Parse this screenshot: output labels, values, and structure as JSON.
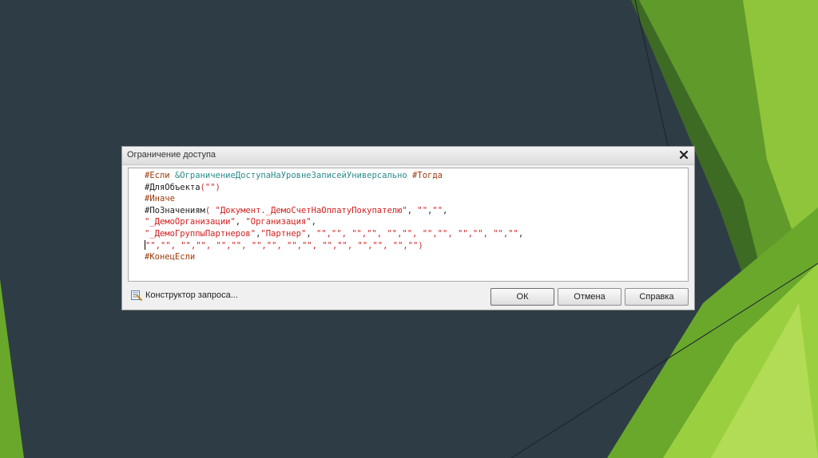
{
  "dialog": {
    "title": "Ограничение доступа",
    "close_icon": "close-icon"
  },
  "editor": {
    "lines": [
      [
        {
          "t": "#Если ",
          "c": "kw-pre"
        },
        {
          "t": "&ОграничениеДоступаНаУровнеЗаписейУниверсально",
          "c": "kw-param"
        },
        {
          "t": " #Тогда",
          "c": "kw-pre"
        }
      ],
      [
        {
          "t": "#ДляОбъекта",
          "c": "func"
        },
        {
          "t": "(",
          "c": "paren"
        },
        {
          "t": "\"\"",
          "c": "str"
        },
        {
          "t": ")",
          "c": "paren"
        }
      ],
      [
        {
          "t": "#Иначе",
          "c": "kw-pre"
        }
      ],
      [
        {
          "t": "#ПоЗначениям",
          "c": "func"
        },
        {
          "t": "( ",
          "c": "paren"
        },
        {
          "t": "\"Документ._ДемоСчетНаОплатуПокупателю\"",
          "c": "str"
        },
        {
          "t": ", ",
          "c": "plain"
        },
        {
          "t": "\"\"",
          "c": "str"
        },
        {
          "t": ",",
          "c": "plain"
        },
        {
          "t": "\"\"",
          "c": "str"
        },
        {
          "t": ",",
          "c": "plain"
        }
      ],
      [
        {
          "t": "\"_ДемоОрганизации\"",
          "c": "str"
        },
        {
          "t": ", ",
          "c": "plain"
        },
        {
          "t": "\"Организация\"",
          "c": "str"
        },
        {
          "t": ",",
          "c": "plain"
        }
      ],
      [
        {
          "t": "\"_ДемоГруппыПартнеров\"",
          "c": "str"
        },
        {
          "t": ",",
          "c": "plain"
        },
        {
          "t": "\"Партнер\"",
          "c": "str"
        },
        {
          "t": ", ",
          "c": "plain"
        },
        {
          "t": "\"\",\"\", \"\",\"\", \"\",\"\", \"\",\"\", \"\",\"\", \"\",\"\"",
          "c": "str"
        },
        {
          "t": ",",
          "c": "plain"
        }
      ],
      [
        {
          "t": "\"\",\"\", \"\",\"\", \"\",\"\", \"\",\"\", \"\",\"\", \"\",\"\", \"\",\"\", \"\",\"\"",
          "c": "str"
        },
        {
          "t": ")",
          "c": "paren"
        }
      ],
      [
        {
          "t": "#КонецЕсли",
          "c": "kw-pre"
        }
      ]
    ]
  },
  "footer": {
    "builder_label": "Конструктор запроса...",
    "builder_icon": "query-builder-icon",
    "ok_label": "ОК",
    "cancel_label": "Отмена",
    "help_label": "Справка"
  },
  "colors": {
    "background": "#2e3d45",
    "accent_green": "#7cbf2a",
    "dark_green": "#3f6e1e"
  }
}
